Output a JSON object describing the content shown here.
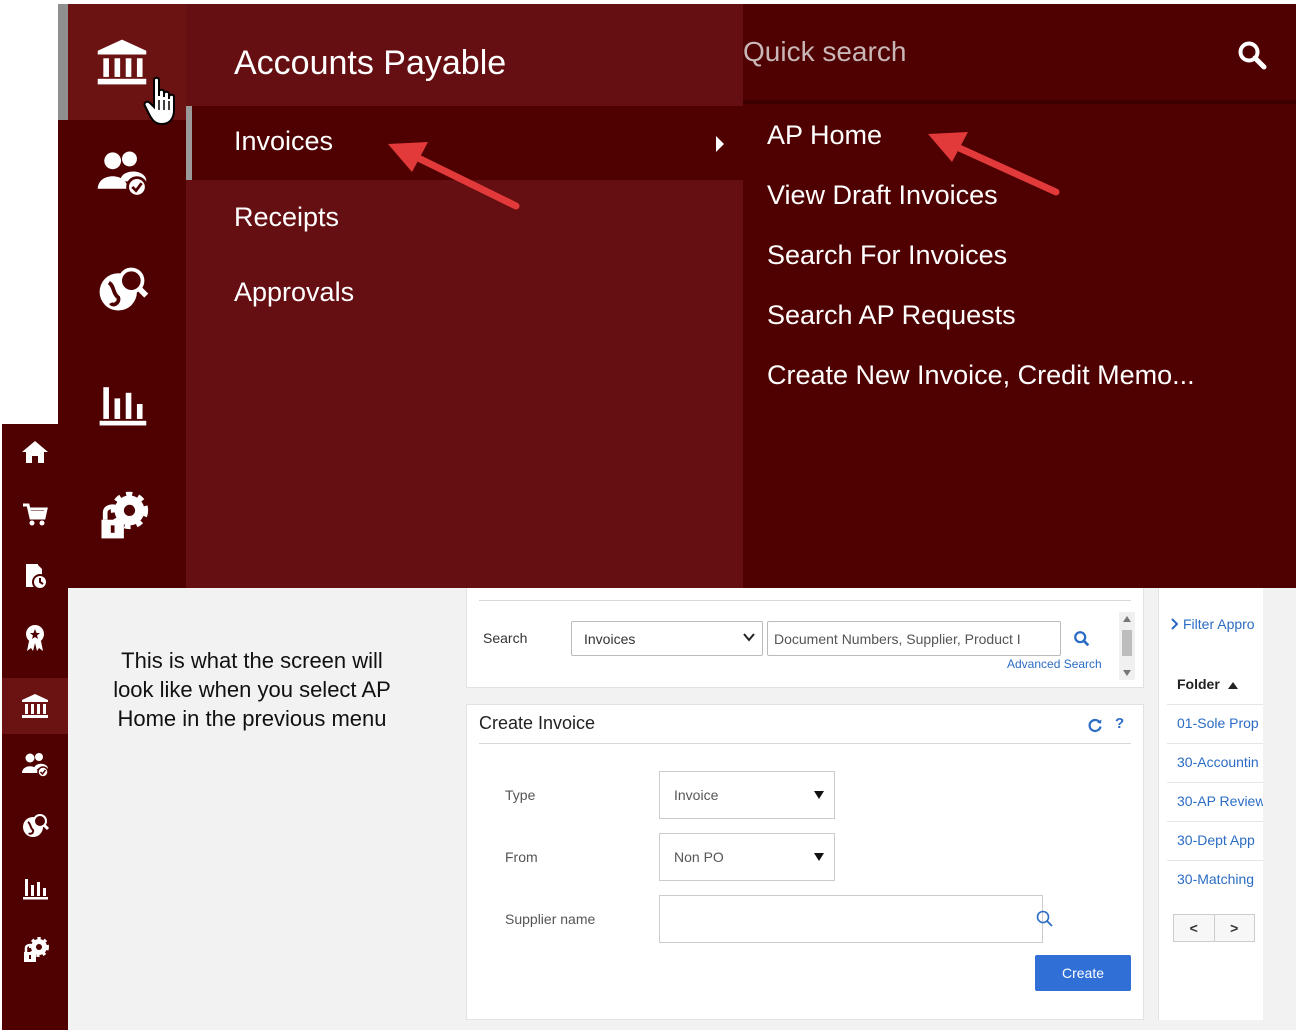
{
  "menu": {
    "section_title": "Accounts Payable",
    "categories": [
      {
        "label": "Invoices"
      },
      {
        "label": "Receipts"
      },
      {
        "label": "Approvals"
      }
    ],
    "quick_search_placeholder": "Quick search",
    "submenu_items": [
      {
        "label": "AP Home"
      },
      {
        "label": "View Draft Invoices"
      },
      {
        "label": "Search For Invoices"
      },
      {
        "label": "Search AP Requests"
      },
      {
        "label": "Create New Invoice, Credit Memo..."
      }
    ],
    "icons": [
      "bank-icon",
      "users-icon",
      "globe-search-icon",
      "bar-chart-icon",
      "gear-lock-icon"
    ]
  },
  "caption": "This is what the screen will look like when you select AP Home in the previous menu",
  "search_panel": {
    "label": "Search",
    "select_value": "Invoices",
    "input_placeholder": "Document Numbers, Supplier, Product I",
    "advanced_link": "Advanced Search"
  },
  "create_invoice": {
    "title": "Create Invoice",
    "help": "?",
    "type_label": "Type",
    "type_value": "Invoice",
    "from_label": "From",
    "from_value": "Non PO",
    "supplier_label": "Supplier name",
    "create_button": "Create"
  },
  "approvals": {
    "filter_link": "Filter Appro",
    "folder_header": "Folder",
    "folders": [
      "01-Sole Prop",
      "30-Accountin",
      "30-AP Review",
      "30-Dept App",
      "30-Matching"
    ],
    "pager_prev": "<",
    "pager_next": ">"
  },
  "colors": {
    "menu_dark": "#4f0000",
    "menu_mid": "#660f12",
    "arrow": "#e23a3a",
    "link_blue": "#2b6cc4",
    "button_blue": "#2f6fd6"
  }
}
